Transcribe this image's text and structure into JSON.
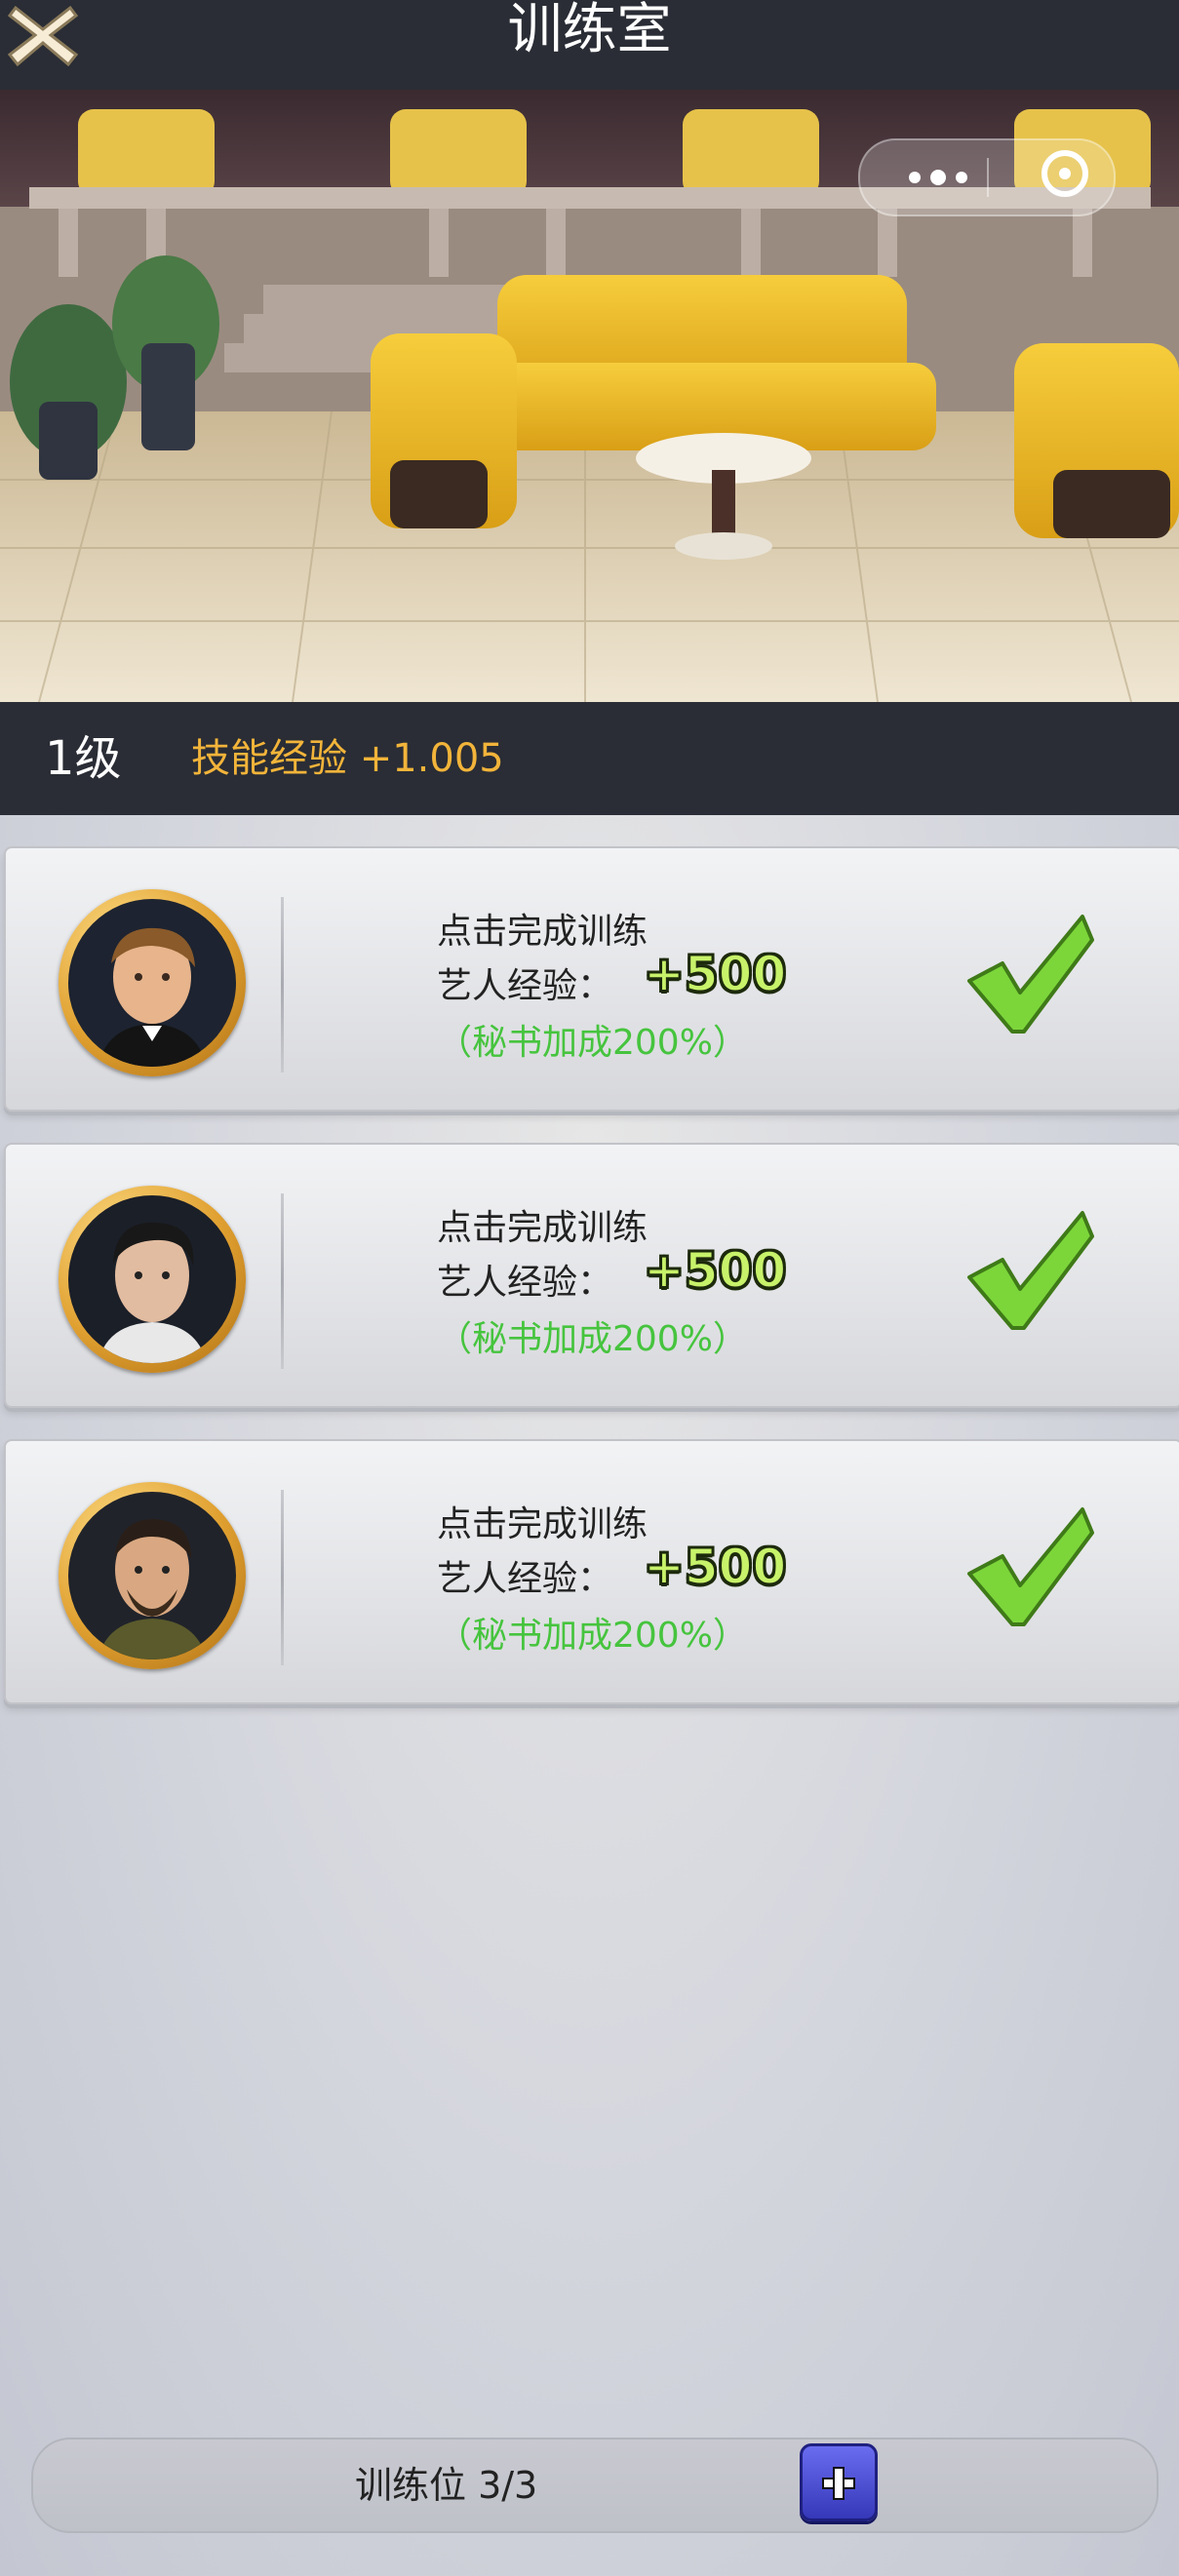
{
  "header": {
    "title": "训练室"
  },
  "room": {
    "level": "1级",
    "skill_bonus": "技能经验 +1.005"
  },
  "trainees": [
    {
      "avatar": "artist-1-portrait",
      "action": "点击完成训练",
      "exp_label": "艺人经验：",
      "exp_value": "+500",
      "bonus": "（秘书加成200%）",
      "status_icon": "checkmark-icon"
    },
    {
      "avatar": "artist-2-portrait",
      "action": "点击完成训练",
      "exp_label": "艺人经验：",
      "exp_value": "+500",
      "bonus": "（秘书加成200%）",
      "status_icon": "checkmark-icon"
    },
    {
      "avatar": "artist-3-portrait",
      "action": "点击完成训练",
      "exp_label": "艺人经验：",
      "exp_value": "+500",
      "bonus": "（秘书加成200%）",
      "status_icon": "checkmark-icon"
    }
  ],
  "footer": {
    "slots": "训练位 3/3"
  },
  "colors": {
    "bar": "#2a2d35",
    "skill_text": "#f2b43a",
    "exp_value": "#c7f26a",
    "bonus_text": "#46c43e",
    "plus_button": "#4b4dd6"
  }
}
